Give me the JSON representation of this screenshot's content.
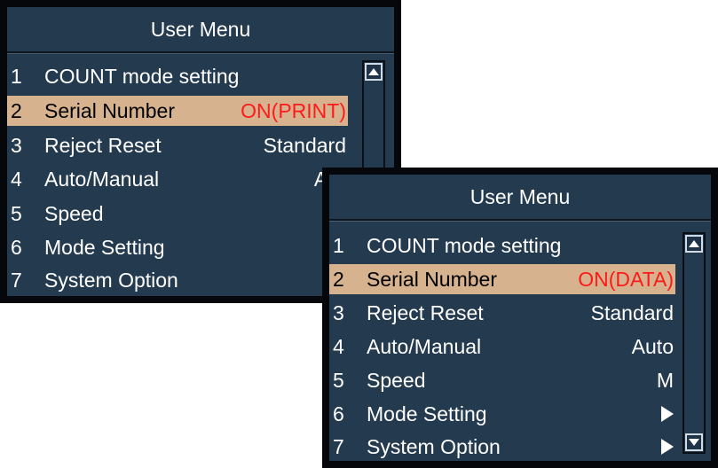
{
  "colors": {
    "panel_bg": "#243a4f",
    "selection_bg": "#d6b38e",
    "selected_value": "#ff1a1a",
    "text": "#ffffff"
  },
  "menu_print": {
    "title": "User Menu",
    "items": [
      {
        "num": "1",
        "label": "COUNT mode setting",
        "value": ""
      },
      {
        "num": "2",
        "label": "Serial Number",
        "value": "ON(PRINT)"
      },
      {
        "num": "3",
        "label": "Reject Reset",
        "value": "Standard"
      },
      {
        "num": "4",
        "label": "Auto/Manual",
        "value": "Au"
      },
      {
        "num": "5",
        "label": "Speed",
        "value": ""
      },
      {
        "num": "6",
        "label": "Mode Setting",
        "value": ""
      },
      {
        "num": "7",
        "label": "System Option",
        "value": ""
      }
    ],
    "selected_index": 1
  },
  "menu_data": {
    "title": "User Menu",
    "items": [
      {
        "num": "1",
        "label": "COUNT mode setting",
        "value": ""
      },
      {
        "num": "2",
        "label": "Serial Number",
        "value": "ON(DATA)"
      },
      {
        "num": "3",
        "label": "Reject Reset",
        "value": "Standard"
      },
      {
        "num": "4",
        "label": "Auto/Manual",
        "value": "Auto"
      },
      {
        "num": "5",
        "label": "Speed",
        "value": "M"
      },
      {
        "num": "6",
        "label": "Mode Setting",
        "value": "",
        "icon": "submenu-arrow-icon"
      },
      {
        "num": "7",
        "label": "System Option",
        "value": "",
        "icon": "submenu-arrow-icon"
      }
    ],
    "selected_index": 1
  },
  "icons": {
    "scroll_up": "scroll-up-icon",
    "scroll_down": "scroll-down-icon",
    "submenu": "submenu-arrow-icon"
  }
}
